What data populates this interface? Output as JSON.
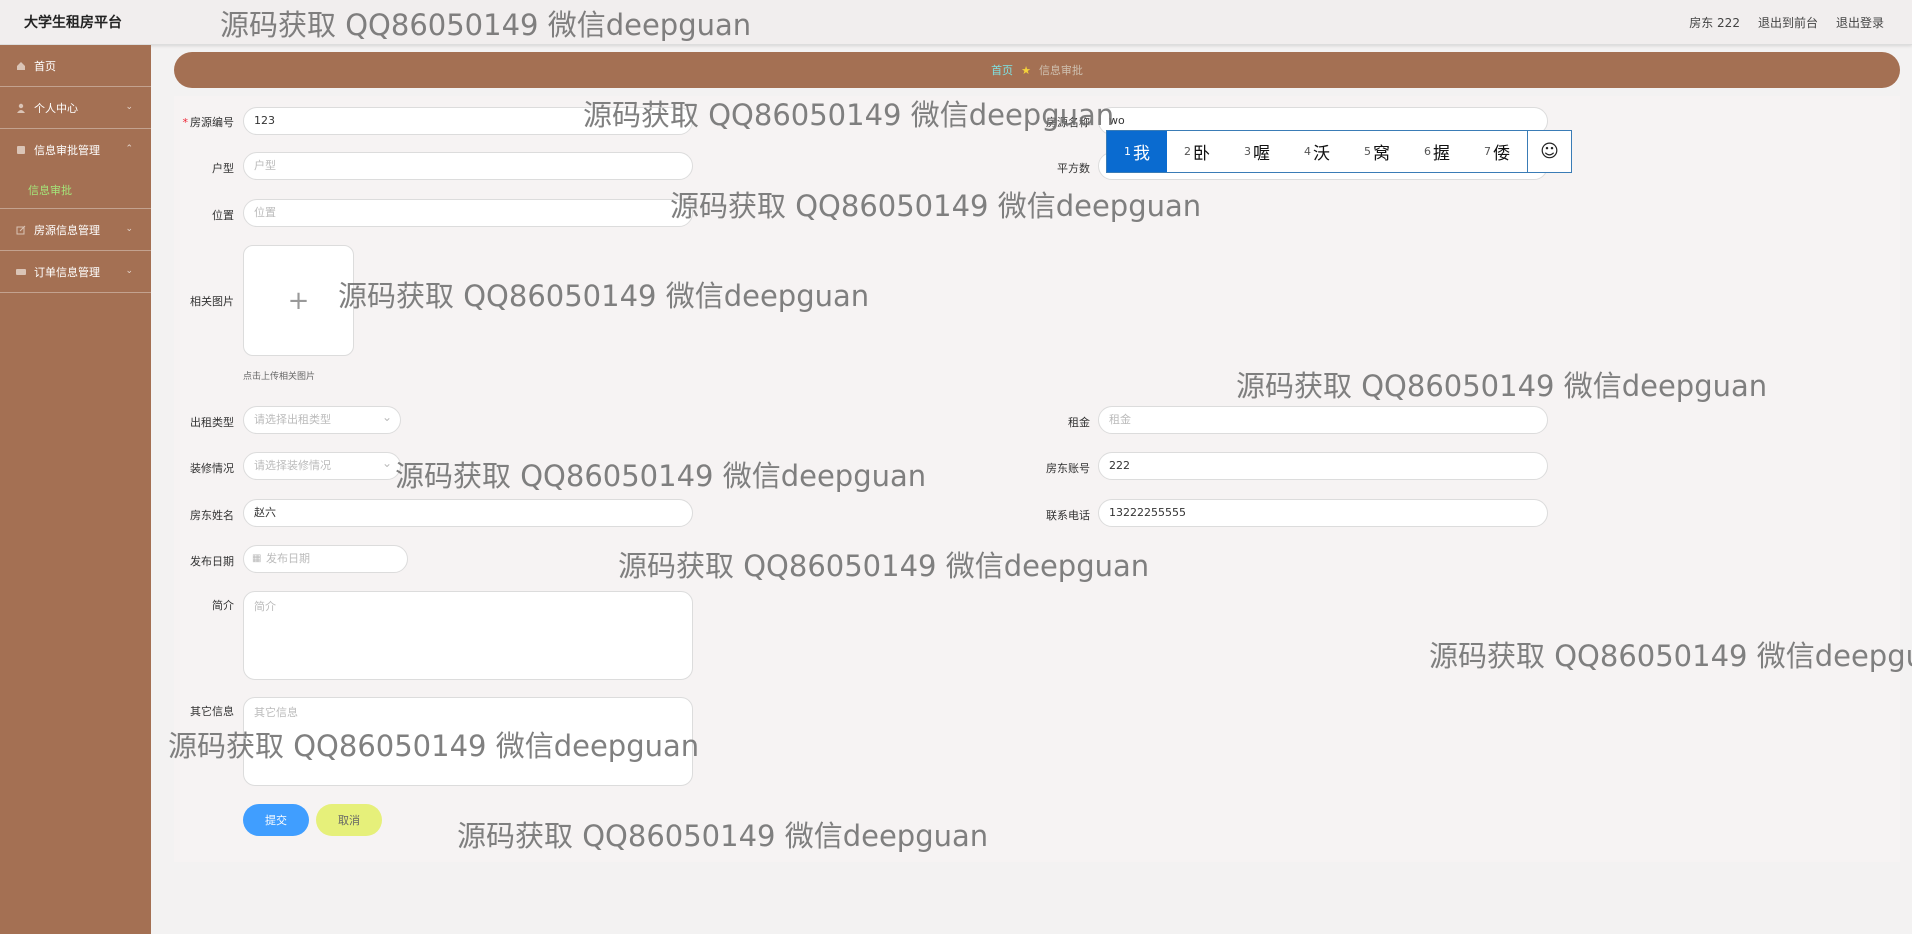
{
  "topbar": {
    "title": "大学生租房平台",
    "user": "房东 222",
    "to_front": "退出到前台",
    "logout": "退出登录"
  },
  "sidebar": {
    "items": [
      {
        "label": "首页",
        "icon": "home-icon"
      },
      {
        "label": "个人中心",
        "icon": "user-icon"
      },
      {
        "label": "信息审批管理",
        "icon": "list-icon"
      },
      {
        "label": "房源信息管理",
        "icon": "edit-icon"
      },
      {
        "label": "订单信息管理",
        "icon": "card-icon"
      }
    ],
    "sub_active": "信息审批"
  },
  "breadcrumb": {
    "home": "首页",
    "current": "信息审批"
  },
  "form": {
    "house_no": {
      "label": "房源编号",
      "value": "123"
    },
    "house_name": {
      "label": "房源名称",
      "value": "wo"
    },
    "type": {
      "label": "户型",
      "placeholder": "户型"
    },
    "area": {
      "label": "平方数"
    },
    "location": {
      "label": "位置",
      "placeholder": "位置"
    },
    "images": {
      "label": "相关图片",
      "hint": "点击上传相关图片"
    },
    "rent_type": {
      "label": "出租类型",
      "placeholder": "请选择出租类型"
    },
    "rent": {
      "label": "租金",
      "placeholder": "租金"
    },
    "decoration": {
      "label": "装修情况",
      "placeholder": "请选择装修情况"
    },
    "landlord_account": {
      "label": "房东账号",
      "value": "222"
    },
    "landlord_name": {
      "label": "房东姓名",
      "value": "赵六"
    },
    "phone": {
      "label": "联系电话",
      "value": "13222255555"
    },
    "date": {
      "label": "发布日期",
      "placeholder": "发布日期"
    },
    "intro": {
      "label": "简介",
      "placeholder": "简介"
    },
    "other": {
      "label": "其它信息",
      "placeholder": "其它信息"
    },
    "submit": "提交",
    "cancel": "取消"
  },
  "ime": {
    "candidates": [
      {
        "n": "1",
        "t": "我"
      },
      {
        "n": "2",
        "t": "卧"
      },
      {
        "n": "3",
        "t": "喔"
      },
      {
        "n": "4",
        "t": "沃"
      },
      {
        "n": "5",
        "t": "窝"
      },
      {
        "n": "6",
        "t": "握"
      },
      {
        "n": "7",
        "t": "倭"
      }
    ],
    "emoji": "☺"
  },
  "watermark": "源码获取 QQ86050149 微信deepguan",
  "colors": {
    "sidebar": "#a47053",
    "submit": "#409eff",
    "cancel": "#e6f07a",
    "ime_selected": "#0a6bd0"
  }
}
